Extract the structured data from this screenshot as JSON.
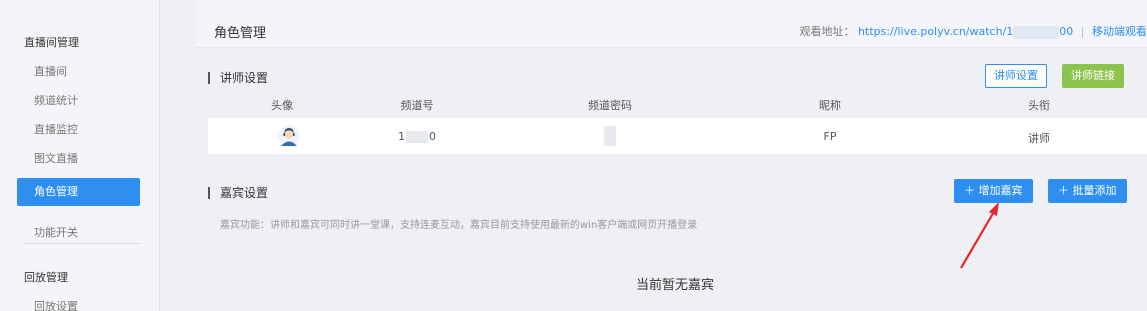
{
  "sidebar": {
    "live_group": "直播间管理",
    "items": [
      "直播间",
      "频道统计",
      "直播监控",
      "图文直播"
    ],
    "active": "角色管理",
    "feature": "功能开关",
    "playback_group": "回放管理",
    "playback_item": "回放设置"
  },
  "header": {
    "title": "角色管理",
    "watch_label": "观看地址：",
    "watch_url_start": "https://live.polyv.cn/watch/1",
    "watch_url_end": "00",
    "separator": "|",
    "mobile_link": "移动端观看"
  },
  "lecturer": {
    "section_title": "讲师设置",
    "settings_button": "讲师设置",
    "link_button": "讲师链接",
    "columns": [
      "头像",
      "频道号",
      "频道密码",
      "昵称",
      "头衔"
    ],
    "row": {
      "channel_start": "1",
      "channel_end": "0",
      "nickname": "FP",
      "title": "讲师"
    }
  },
  "guest": {
    "section_title": "嘉宾设置",
    "add_button": "＋ 增加嘉宾",
    "batch_button": "＋ 批量添加",
    "description": "嘉宾功能：讲师和嘉宾可同时讲一堂课，支持连麦互动，嘉宾目前支持使用最新的win客户端或网页开播登录",
    "empty_text": "当前暂无嘉宾"
  },
  "colors": {
    "primary": "#2f8ff0",
    "green": "#8cc34a",
    "annotation_arrow": "#e8262a"
  }
}
